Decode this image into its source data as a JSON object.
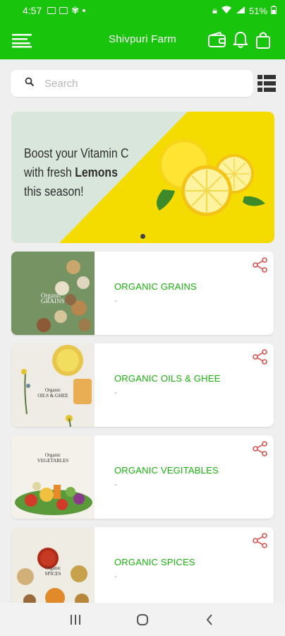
{
  "status_bar": {
    "time": "4:57",
    "battery": "51%"
  },
  "app_bar": {
    "title": "Shivpuri Farm",
    "icons": [
      "menu-icon",
      "wallet-icon",
      "bell-icon",
      "shopping-bag-icon"
    ]
  },
  "search": {
    "placeholder": "Search",
    "value": ""
  },
  "banner": {
    "line1": "Boost your Vitamin C",
    "line2_prefix": "with fresh ",
    "line2_bold": "Lemons",
    "line3": "this season!",
    "colors": {
      "yellow": "#f5dc00",
      "mint": "#d8e6dc"
    }
  },
  "categories": [
    {
      "name": "ORGANIC GRAINS",
      "sub": "-",
      "thumb_title": "Organic",
      "thumb_sub": "GRAINS"
    },
    {
      "name": "ORGANIC OILS & GHEE",
      "sub": "-",
      "thumb_title": "Organic",
      "thumb_sub": "OILS & GHEE"
    },
    {
      "name": "ORGANIC VEGITABLES",
      "sub": "-",
      "thumb_title": "Organic",
      "thumb_sub": "VEGETABLES"
    },
    {
      "name": "ORGANIC SPICES",
      "sub": "-",
      "thumb_title": "Organic",
      "thumb_sub": "SPICES"
    }
  ],
  "theme": {
    "primary": "#18c40c",
    "category_text": "#18b40c",
    "share_icon": "#d9534f"
  }
}
